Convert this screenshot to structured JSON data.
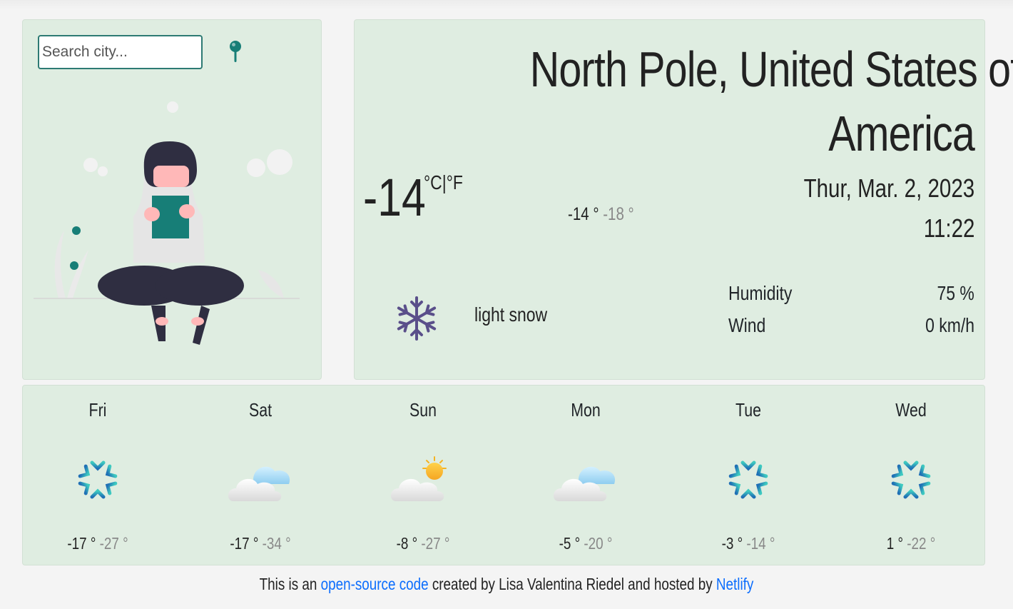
{
  "search": {
    "placeholder": "Search city..."
  },
  "current": {
    "city_line1": "North Pole, United States of",
    "city_line2": "America",
    "temperature": "-14",
    "unit_c": "°C",
    "unit_sep": "|",
    "unit_f": "°F",
    "high": "-14 °",
    "low": "-18 °",
    "date": "Thur, Mar. 2, 2023",
    "time": "11:22",
    "description": "light snow",
    "icon": "snowflake-icon",
    "humidity_label": "Humidity",
    "humidity_value": "75 %",
    "wind_label": "Wind",
    "wind_value": "0 km/h"
  },
  "forecast": [
    {
      "day": "Fri",
      "icon": "snowflake-icon",
      "high": "-17 °",
      "low": "-27 °"
    },
    {
      "day": "Sat",
      "icon": "cloud-icon",
      "high": "-17 °",
      "low": "-34 °"
    },
    {
      "day": "Sun",
      "icon": "partly-sunny-icon",
      "high": "-8 °",
      "low": "-27 °"
    },
    {
      "day": "Mon",
      "icon": "cloud-icon",
      "high": "-5 °",
      "low": "-20 °"
    },
    {
      "day": "Tue",
      "icon": "snowflake-icon",
      "high": "-3 °",
      "low": "-14 °"
    },
    {
      "day": "Wed",
      "icon": "snowflake-icon",
      "high": "1 °",
      "low": "-22 °"
    }
  ],
  "footer": {
    "prefix": "This is an",
    "code_link": "open-source code",
    "middle": "created by Lisa Valentina Riedel and hosted by",
    "host_link": "Netlify"
  },
  "colors": {
    "card_bg": "#dfede1",
    "accent": "#2d7a73",
    "link": "#0d6efd",
    "current_icon": "#5a4f8a"
  }
}
